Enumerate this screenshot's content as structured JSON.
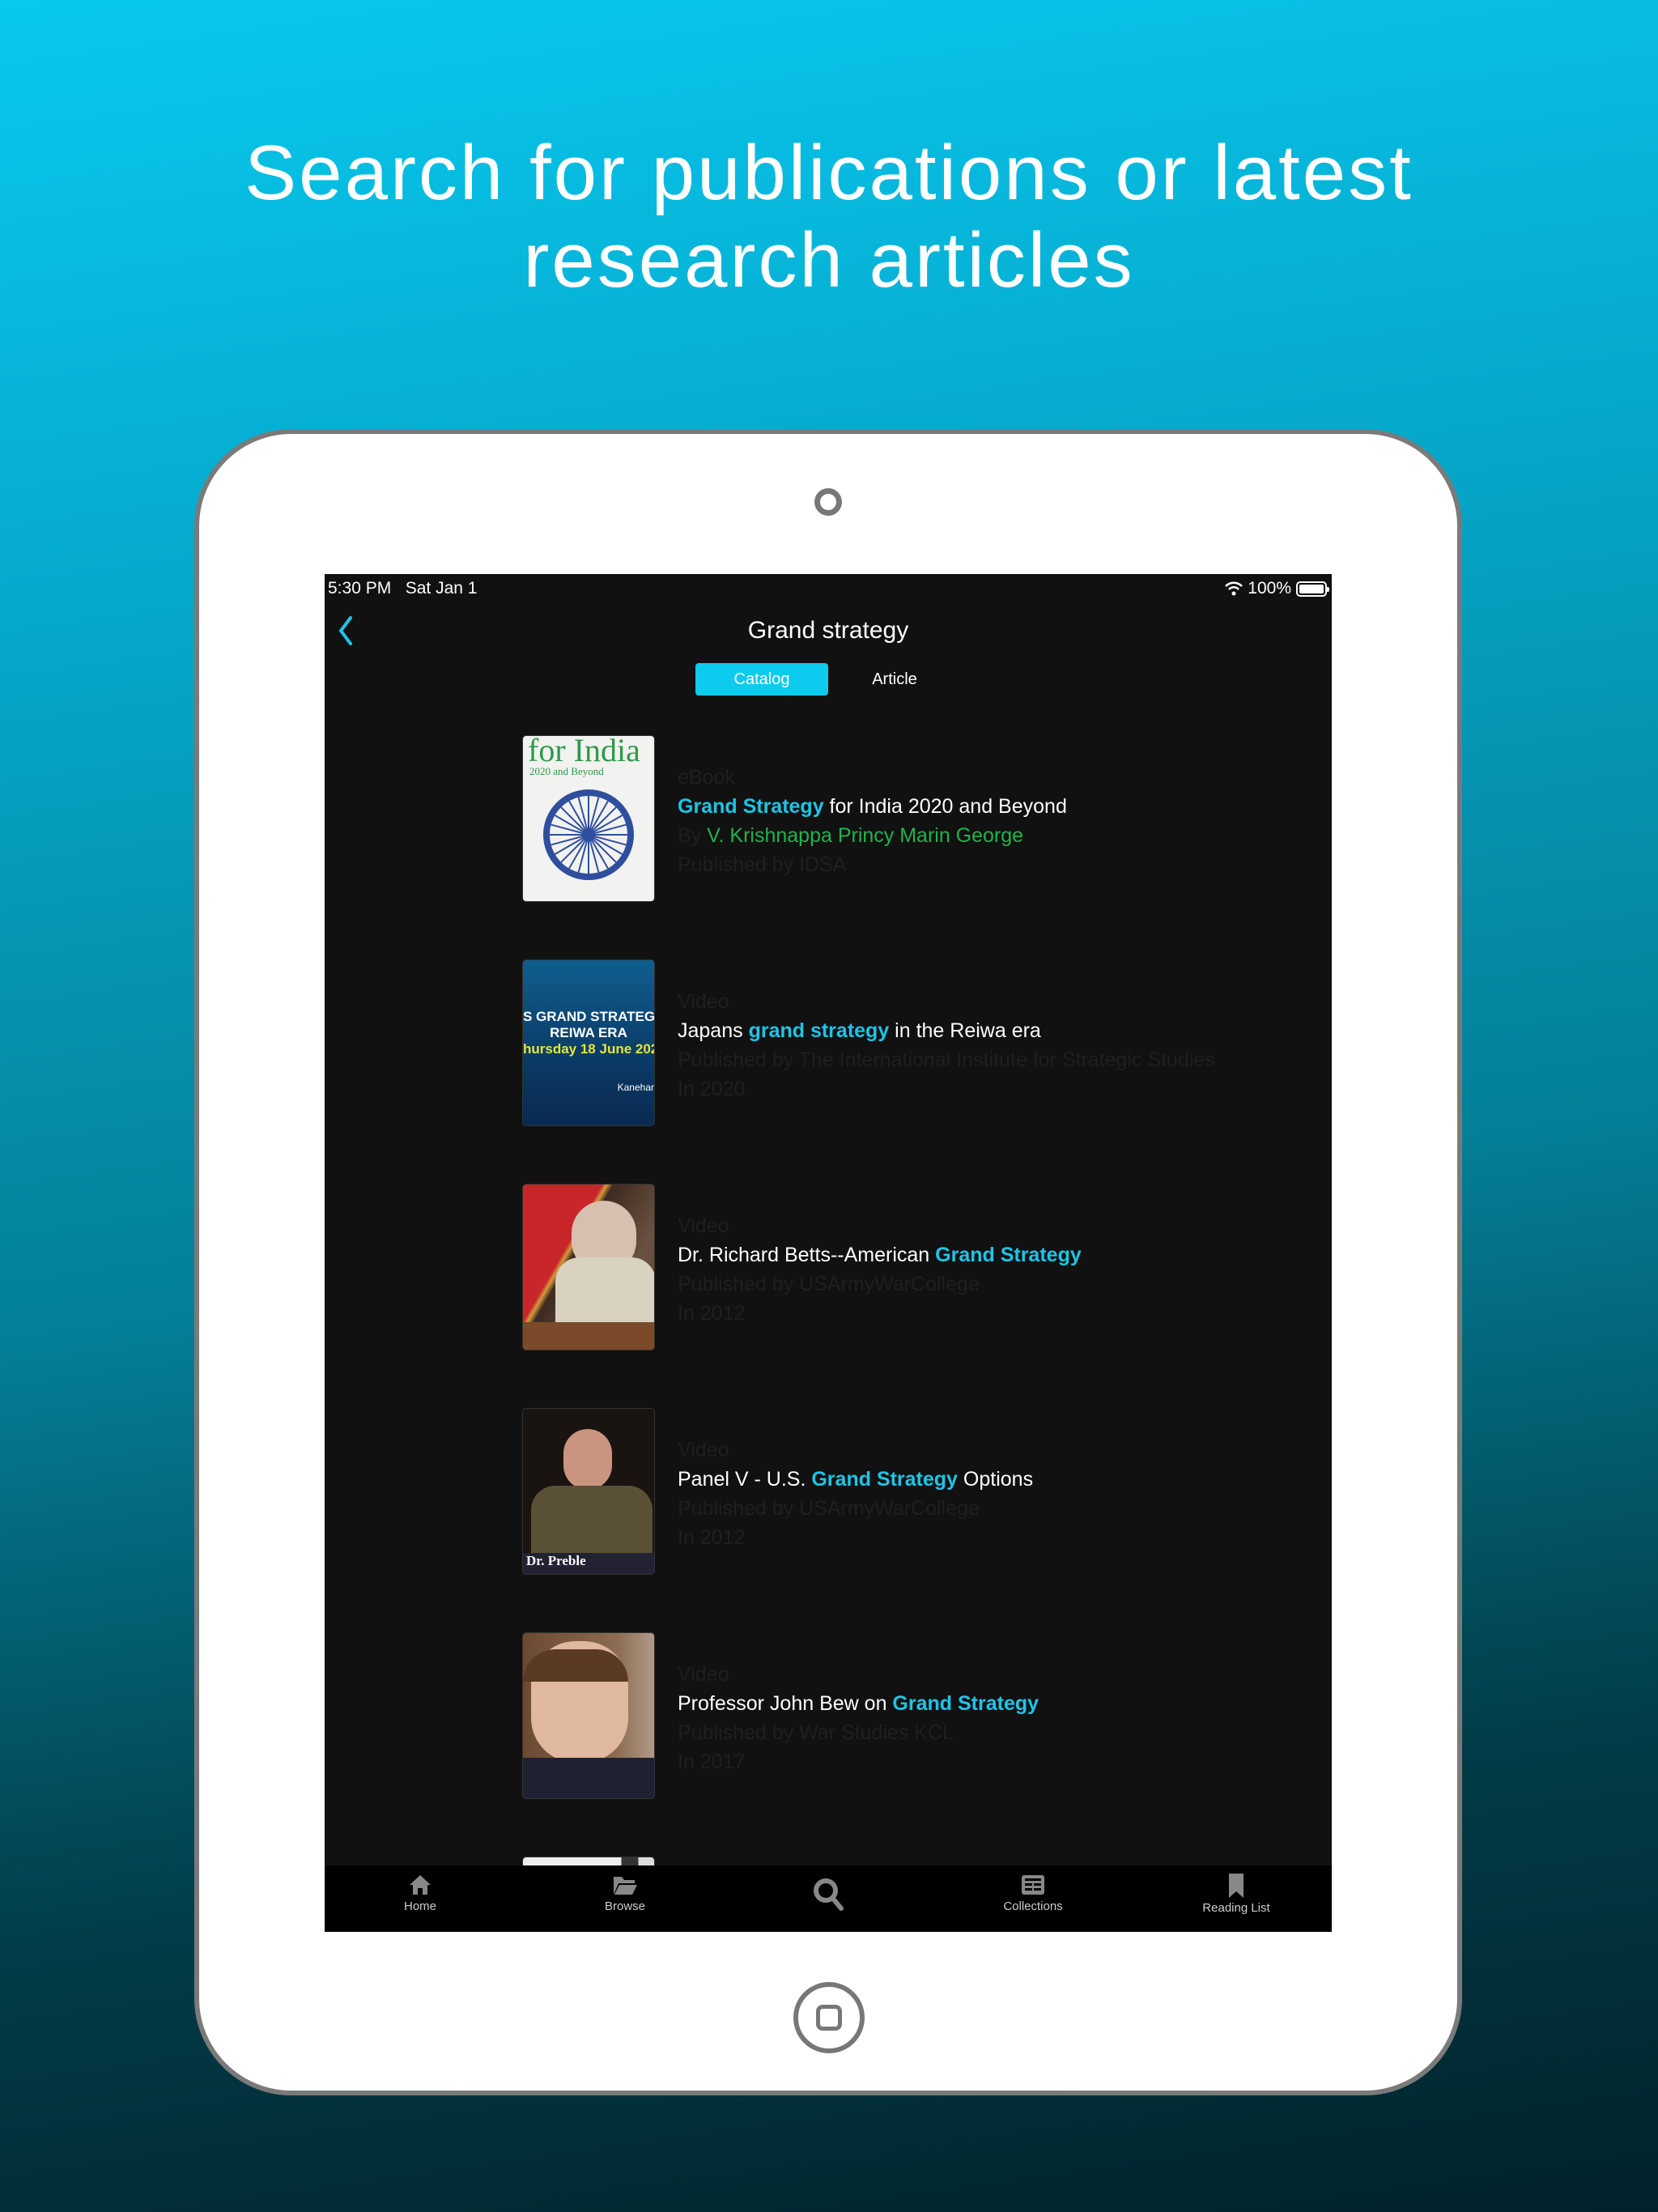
{
  "headline": {
    "line1": "Search for publications or latest",
    "line2": "research articles"
  },
  "status_bar": {
    "time": "5:30 PM",
    "date": "Sat Jan 1",
    "battery": "100%",
    "battery_level": 100
  },
  "nav": {
    "title": "Grand strategy",
    "back_icon": "chevron-left-icon"
  },
  "segments": {
    "items": [
      {
        "label": "Catalog",
        "active": true
      },
      {
        "label": "Article",
        "active": false
      }
    ]
  },
  "colors": {
    "accent": "#1ec4e7",
    "author": "#21b34c",
    "background": "#111111"
  },
  "results": [
    {
      "type": "eBook",
      "title": [
        {
          "t": "Grand Strategy",
          "hl": true
        },
        {
          "t": " for India 2020 and Beyond",
          "hl": false
        }
      ],
      "by_label": "By",
      "author": "V. Krishnappa Princy Marin George",
      "publisher": "Published by IDSA",
      "thumb": "book-cover-india"
    },
    {
      "type": "Video",
      "title": [
        {
          "t": "Japans ",
          "hl": false
        },
        {
          "t": "grand strategy",
          "hl": true
        },
        {
          "t": " in the Reiwa era",
          "hl": false
        }
      ],
      "publisher": "Published by The International Institute for Strategic Studies",
      "year": "In 2020",
      "thumb": "video-japan",
      "thumb_text": [
        "S GRAND STRATEGY",
        "REIWA ERA",
        "hursday 18 June 202",
        "Kanehar"
      ]
    },
    {
      "type": "Video",
      "title": [
        {
          "t": "Dr. Richard Betts--American ",
          "hl": false
        },
        {
          "t": "Grand Strategy",
          "hl": true
        }
      ],
      "publisher": "Published by USArmyWarCollege",
      "year": "In 2012",
      "thumb": "video-betts"
    },
    {
      "type": "Video",
      "title": [
        {
          "t": "Panel V - U.S. ",
          "hl": false
        },
        {
          "t": "Grand Strategy",
          "hl": true
        },
        {
          "t": " Options",
          "hl": false
        }
      ],
      "publisher": "Published by USArmyWarCollege",
      "year": "In 2012",
      "thumb": "video-preble",
      "thumb_text": [
        "Dr. Preble"
      ]
    },
    {
      "type": "Video",
      "title": [
        {
          "t": "Professor John Bew on ",
          "hl": false
        },
        {
          "t": "Grand Strategy",
          "hl": true
        }
      ],
      "publisher": "Published by War Studies KCL",
      "year": "In 2017",
      "thumb": "video-bew"
    }
  ],
  "tabbar": {
    "items": [
      {
        "label": "Home",
        "icon": "home-icon"
      },
      {
        "label": "Browse",
        "icon": "folder-icon"
      },
      {
        "label": "",
        "icon": "search-icon"
      },
      {
        "label": "Collections",
        "icon": "collections-icon"
      },
      {
        "label": "Reading List",
        "icon": "bookmark-icon"
      }
    ]
  }
}
